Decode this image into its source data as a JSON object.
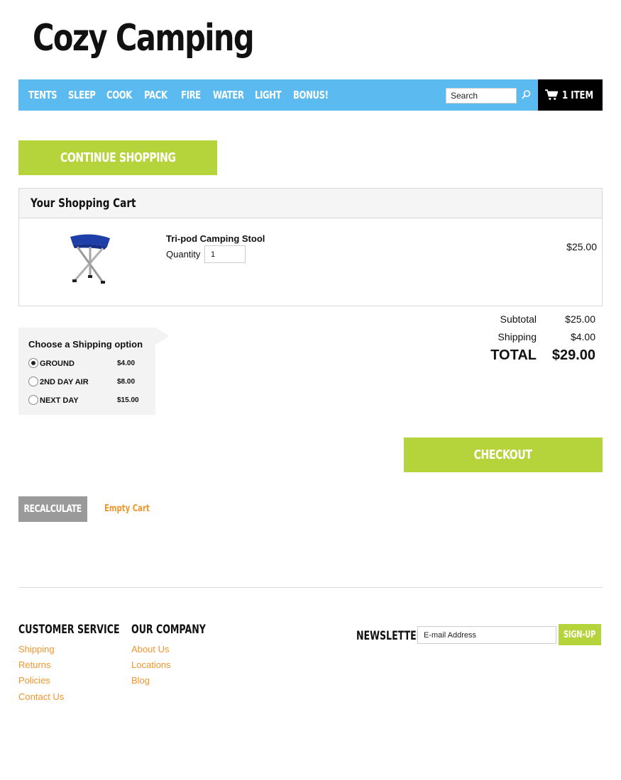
{
  "site": {
    "logo": "Cozy Camping"
  },
  "nav": {
    "items": [
      {
        "label": "TENTS"
      },
      {
        "label": "SLEEP"
      },
      {
        "label": "COOK"
      },
      {
        "label": "PACK"
      },
      {
        "label": "FIRE"
      },
      {
        "label": "WATER"
      },
      {
        "label": "LIGHT"
      },
      {
        "label": "BONUS!"
      }
    ],
    "search_placeholder": "Search",
    "cart_label": "1 ITEM",
    "bar_color": "#5bbaf0"
  },
  "actions": {
    "continue_label": "CONTINUE SHOPPING",
    "checkout_label": "CHECKOUT",
    "recalculate_label": "RECALCULATE",
    "empty_cart_label": "Empty Cart",
    "accent_green": "#b5d33a",
    "accent_orange": "#f0962d"
  },
  "cart": {
    "title": "Your Shopping Cart",
    "items": [
      {
        "name": "Tri-pod Camping Stool",
        "quantity_label": "Quantity",
        "quantity": "1",
        "price": "$25.00"
      }
    ]
  },
  "shipping": {
    "title": "Choose a Shipping option",
    "options": [
      {
        "name": "GROUND",
        "price": "$4.00",
        "selected": true
      },
      {
        "name": "2ND DAY AIR",
        "price": "$8.00",
        "selected": false
      },
      {
        "name": "NEXT DAY",
        "price": "$15.00",
        "selected": false
      }
    ]
  },
  "totals": {
    "subtotal_label": "Subtotal",
    "subtotal": "$25.00",
    "shipping_label": "Shipping",
    "shipping": "$4.00",
    "total_label": "TOTAL",
    "total": "$29.00"
  },
  "footer": {
    "customer_service": {
      "title": "CUSTOMER SERVICE",
      "links": [
        "Shipping",
        "Returns",
        "Policies",
        "Contact Us"
      ]
    },
    "our_company": {
      "title": "OUR COMPANY",
      "links": [
        "About Us",
        "Locations",
        "Blog"
      ]
    },
    "newsletter": {
      "label": "NEWSLETTER",
      "placeholder": "E-mail Address",
      "button": "SIGN-UP"
    }
  }
}
